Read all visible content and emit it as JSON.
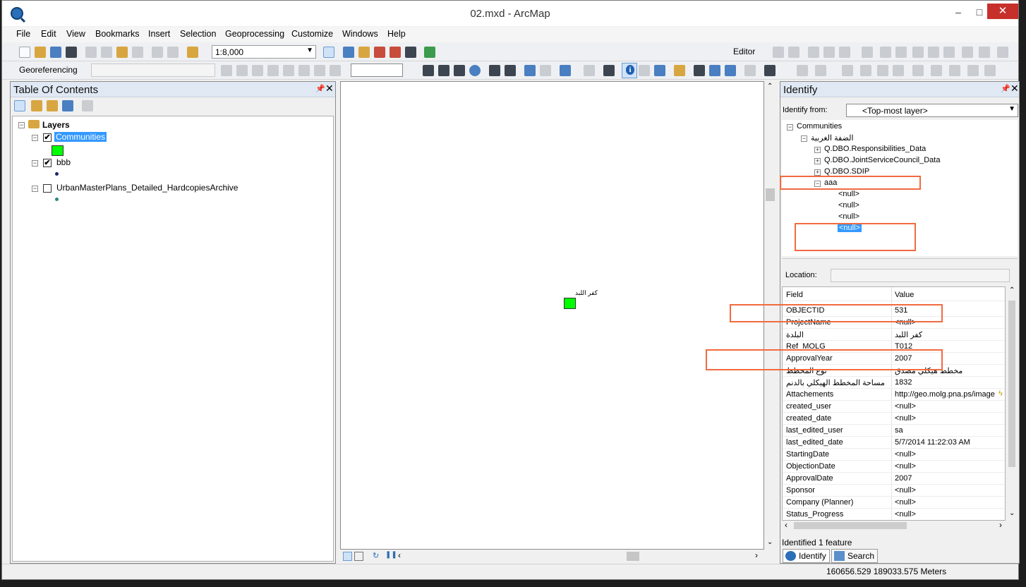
{
  "window": {
    "title": "02.mxd - ArcMap",
    "minimize": "–",
    "maximize": "□",
    "close": "✕"
  },
  "menu": [
    "File",
    "Edit",
    "View",
    "Bookmarks",
    "Insert",
    "Selection",
    "Geoprocessing",
    "Customize",
    "Windows",
    "Help"
  ],
  "toolbar": {
    "scale": "1:8,000",
    "editor": "Editor",
    "georeferencing": "Georeferencing"
  },
  "toc": {
    "title": "Table Of Contents",
    "root": "Layers",
    "layers": [
      {
        "name": "Communities",
        "checked": "✔"
      },
      {
        "name": "bbb",
        "checked": "✔"
      },
      {
        "name": "UrbanMasterPlans_Detailed_HardcopiesArchive",
        "checked": ""
      }
    ]
  },
  "map": {
    "feature_label": "كفر اللبد"
  },
  "identify": {
    "title": "Identify",
    "from_label": "Identify from:",
    "from_value": "<Top-most layer>",
    "tree": {
      "root": "Communities",
      "child": "الضفة الغربية",
      "relations": [
        "Q.DBO.Responsibilities_Data",
        "Q.DBO.JointServiceCouncil_Data",
        "Q.DBO.SDIP",
        "aaa"
      ],
      "nulls": [
        "<null>",
        "<null>",
        "<null>",
        "<null>"
      ]
    },
    "location_label": "Location:",
    "col_field": "Field",
    "col_value": "Value",
    "rows": [
      {
        "field": "OBJECTID",
        "value": "531"
      },
      {
        "field": "ProjectName",
        "value": "<null>"
      },
      {
        "field": "البلدة",
        "value": "كفر اللبد"
      },
      {
        "field": "Ref_MOLG",
        "value": "T012"
      },
      {
        "field": "ApprovalYear",
        "value": "2007"
      },
      {
        "field": "نوع المخطط",
        "value": "مخطط هيكلي مصدق"
      },
      {
        "field": "مساحة المخطط الهيكلي بالدنم",
        "value": "1832"
      },
      {
        "field": "Attachements",
        "value": "http://geo.molg.pna.ps/image"
      },
      {
        "field": "created_user",
        "value": "<null>"
      },
      {
        "field": "created_date",
        "value": "<null>"
      },
      {
        "field": "last_edited_user",
        "value": "sa"
      },
      {
        "field": "last_edited_date",
        "value": "5/7/2014 11:22:03 AM"
      },
      {
        "field": "StartingDate",
        "value": "<null>"
      },
      {
        "field": "ObjectionDate",
        "value": "<null>"
      },
      {
        "field": "ApprovalDate",
        "value": "2007"
      },
      {
        "field": "Sponsor",
        "value": "<null>"
      },
      {
        "field": "Company (Planner)",
        "value": "<null>"
      },
      {
        "field": "Status_Progress",
        "value": "<null>"
      }
    ],
    "status": "Identified 1 feature",
    "tab_identify": "Identify",
    "tab_search": "Search"
  },
  "status": {
    "coordinates": "160656.529  189033.575 Meters"
  },
  "colors": {
    "highlight_box": "#f26a3f",
    "selection": "#3399ff",
    "feature_fill": "#00ff00"
  }
}
